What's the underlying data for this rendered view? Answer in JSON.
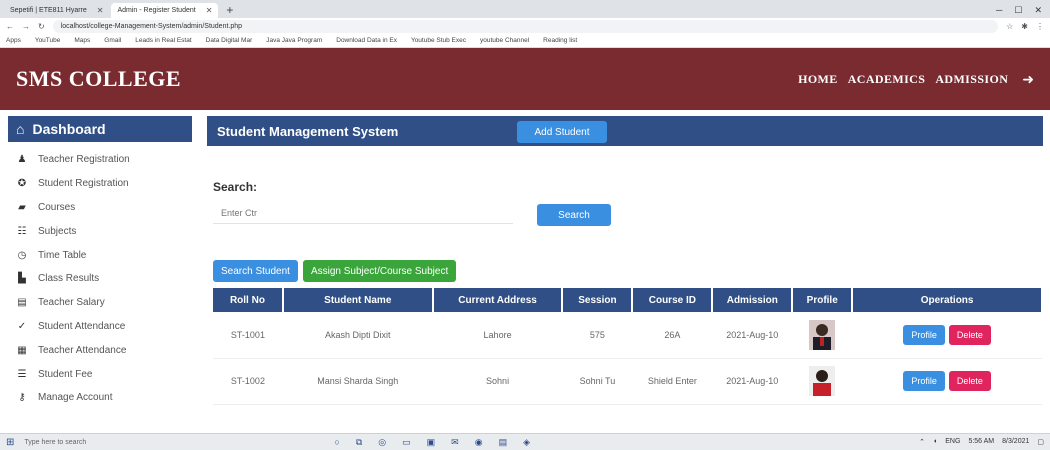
{
  "browser": {
    "tabs": [
      {
        "title": "Sepetifi | ETE811 Hyarre"
      },
      {
        "title": "Admin - Register Student"
      }
    ],
    "url": "localhost/college-Management-System/admin/Student.php",
    "bookmarks": [
      "Apps",
      "YouTube",
      "Maps",
      "Gmail",
      "Leads in Real Estat",
      "Data Digital Mar",
      "Java Java Program",
      "Download Data in Ex",
      "Youtube Stub Exec",
      "youtube Channel",
      "Reading list"
    ]
  },
  "header": {
    "brand": "SMS COLLEGE",
    "nav": [
      "HOME",
      "ACADEMICS",
      "ADMISSION"
    ]
  },
  "sidebar": {
    "dashboard": "Dashboard",
    "items": [
      {
        "label": "Teacher Registration",
        "icon": "user-icon"
      },
      {
        "label": "Student Registration",
        "icon": "graduation-icon"
      },
      {
        "label": "Courses",
        "icon": "book-icon"
      },
      {
        "label": "Subjects",
        "icon": "list-icon"
      },
      {
        "label": "Time Table",
        "icon": "clock-icon"
      },
      {
        "label": "Class Results",
        "icon": "chart-icon"
      },
      {
        "label": "Teacher Salary",
        "icon": "money-icon"
      },
      {
        "label": "Student Attendance",
        "icon": "check-icon"
      },
      {
        "label": "Teacher Attendance",
        "icon": "calendar-icon"
      },
      {
        "label": "Student Fee",
        "icon": "receipt-icon"
      },
      {
        "label": "Manage Account",
        "icon": "key-icon"
      }
    ]
  },
  "main": {
    "title": "Student Management System",
    "add_button": "Add Student",
    "search_label": "Search:",
    "search_placeholder": "Enter Ctr",
    "search_button": "Search",
    "action_buttons": [
      "Search Student",
      "Assign Subject/Course Subject"
    ],
    "table": {
      "headers": [
        "Roll No",
        "Student Name",
        "Current Address",
        "Session",
        "Course ID",
        "Admission",
        "Profile",
        "Operations"
      ],
      "rows": [
        {
          "roll": "ST-1001",
          "name": "Akash Dipti Dixit",
          "address": "Lahore",
          "session": "575",
          "course": "26A",
          "admission": "2021-Aug-10"
        },
        {
          "roll": "ST-1002",
          "name": "Mansi Sharda Singh",
          "address": "Sohni",
          "session": "Sohni Tu",
          "course": "Shield Enter",
          "admission": "2021-Aug-10"
        }
      ],
      "profile_button": "Profile",
      "delete_button": "Delete"
    }
  },
  "taskbar": {
    "search": "Type here to search",
    "time": "5:56 AM",
    "date": "8/3/2021",
    "lang": "ENG"
  },
  "colors": {
    "header_bg": "#7a2b2f",
    "panel_blue": "#2f4f86",
    "button_blue": "#3b8fe0",
    "button_green": "#3aa53a",
    "button_delete": "#e0245e"
  }
}
